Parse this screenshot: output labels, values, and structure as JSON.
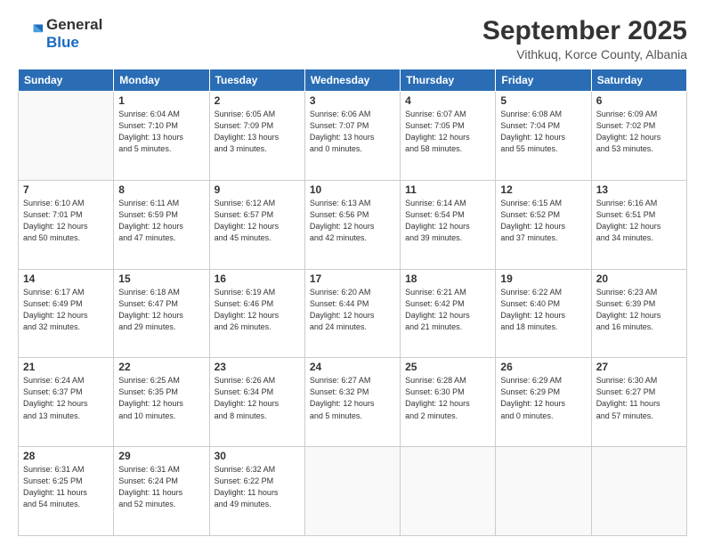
{
  "logo": {
    "general": "General",
    "blue": "Blue"
  },
  "title": "September 2025",
  "subtitle": "Vithkuq, Korce County, Albania",
  "days_header": [
    "Sunday",
    "Monday",
    "Tuesday",
    "Wednesday",
    "Thursday",
    "Friday",
    "Saturday"
  ],
  "weeks": [
    [
      {
        "num": "",
        "info": ""
      },
      {
        "num": "1",
        "info": "Sunrise: 6:04 AM\nSunset: 7:10 PM\nDaylight: 13 hours\nand 5 minutes."
      },
      {
        "num": "2",
        "info": "Sunrise: 6:05 AM\nSunset: 7:09 PM\nDaylight: 13 hours\nand 3 minutes."
      },
      {
        "num": "3",
        "info": "Sunrise: 6:06 AM\nSunset: 7:07 PM\nDaylight: 13 hours\nand 0 minutes."
      },
      {
        "num": "4",
        "info": "Sunrise: 6:07 AM\nSunset: 7:05 PM\nDaylight: 12 hours\nand 58 minutes."
      },
      {
        "num": "5",
        "info": "Sunrise: 6:08 AM\nSunset: 7:04 PM\nDaylight: 12 hours\nand 55 minutes."
      },
      {
        "num": "6",
        "info": "Sunrise: 6:09 AM\nSunset: 7:02 PM\nDaylight: 12 hours\nand 53 minutes."
      }
    ],
    [
      {
        "num": "7",
        "info": "Sunrise: 6:10 AM\nSunset: 7:01 PM\nDaylight: 12 hours\nand 50 minutes."
      },
      {
        "num": "8",
        "info": "Sunrise: 6:11 AM\nSunset: 6:59 PM\nDaylight: 12 hours\nand 47 minutes."
      },
      {
        "num": "9",
        "info": "Sunrise: 6:12 AM\nSunset: 6:57 PM\nDaylight: 12 hours\nand 45 minutes."
      },
      {
        "num": "10",
        "info": "Sunrise: 6:13 AM\nSunset: 6:56 PM\nDaylight: 12 hours\nand 42 minutes."
      },
      {
        "num": "11",
        "info": "Sunrise: 6:14 AM\nSunset: 6:54 PM\nDaylight: 12 hours\nand 39 minutes."
      },
      {
        "num": "12",
        "info": "Sunrise: 6:15 AM\nSunset: 6:52 PM\nDaylight: 12 hours\nand 37 minutes."
      },
      {
        "num": "13",
        "info": "Sunrise: 6:16 AM\nSunset: 6:51 PM\nDaylight: 12 hours\nand 34 minutes."
      }
    ],
    [
      {
        "num": "14",
        "info": "Sunrise: 6:17 AM\nSunset: 6:49 PM\nDaylight: 12 hours\nand 32 minutes."
      },
      {
        "num": "15",
        "info": "Sunrise: 6:18 AM\nSunset: 6:47 PM\nDaylight: 12 hours\nand 29 minutes."
      },
      {
        "num": "16",
        "info": "Sunrise: 6:19 AM\nSunset: 6:46 PM\nDaylight: 12 hours\nand 26 minutes."
      },
      {
        "num": "17",
        "info": "Sunrise: 6:20 AM\nSunset: 6:44 PM\nDaylight: 12 hours\nand 24 minutes."
      },
      {
        "num": "18",
        "info": "Sunrise: 6:21 AM\nSunset: 6:42 PM\nDaylight: 12 hours\nand 21 minutes."
      },
      {
        "num": "19",
        "info": "Sunrise: 6:22 AM\nSunset: 6:40 PM\nDaylight: 12 hours\nand 18 minutes."
      },
      {
        "num": "20",
        "info": "Sunrise: 6:23 AM\nSunset: 6:39 PM\nDaylight: 12 hours\nand 16 minutes."
      }
    ],
    [
      {
        "num": "21",
        "info": "Sunrise: 6:24 AM\nSunset: 6:37 PM\nDaylight: 12 hours\nand 13 minutes."
      },
      {
        "num": "22",
        "info": "Sunrise: 6:25 AM\nSunset: 6:35 PM\nDaylight: 12 hours\nand 10 minutes."
      },
      {
        "num": "23",
        "info": "Sunrise: 6:26 AM\nSunset: 6:34 PM\nDaylight: 12 hours\nand 8 minutes."
      },
      {
        "num": "24",
        "info": "Sunrise: 6:27 AM\nSunset: 6:32 PM\nDaylight: 12 hours\nand 5 minutes."
      },
      {
        "num": "25",
        "info": "Sunrise: 6:28 AM\nSunset: 6:30 PM\nDaylight: 12 hours\nand 2 minutes."
      },
      {
        "num": "26",
        "info": "Sunrise: 6:29 AM\nSunset: 6:29 PM\nDaylight: 12 hours\nand 0 minutes."
      },
      {
        "num": "27",
        "info": "Sunrise: 6:30 AM\nSunset: 6:27 PM\nDaylight: 11 hours\nand 57 minutes."
      }
    ],
    [
      {
        "num": "28",
        "info": "Sunrise: 6:31 AM\nSunset: 6:25 PM\nDaylight: 11 hours\nand 54 minutes."
      },
      {
        "num": "29",
        "info": "Sunrise: 6:31 AM\nSunset: 6:24 PM\nDaylight: 11 hours\nand 52 minutes."
      },
      {
        "num": "30",
        "info": "Sunrise: 6:32 AM\nSunset: 6:22 PM\nDaylight: 11 hours\nand 49 minutes."
      },
      {
        "num": "",
        "info": ""
      },
      {
        "num": "",
        "info": ""
      },
      {
        "num": "",
        "info": ""
      },
      {
        "num": "",
        "info": ""
      }
    ]
  ]
}
